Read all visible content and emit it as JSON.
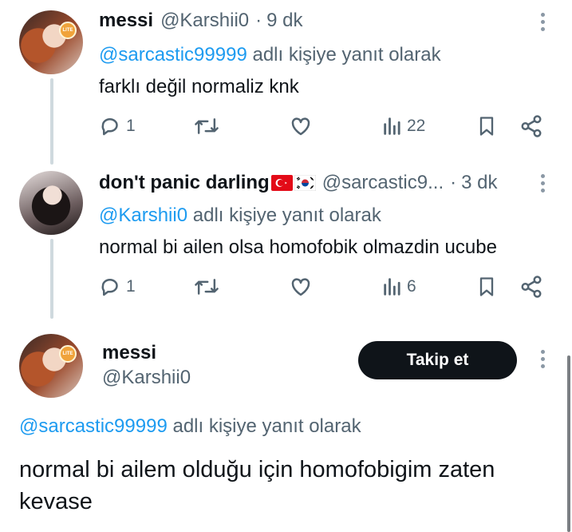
{
  "tweets": [
    {
      "display_name": "messi",
      "handle": "@Karshii0",
      "sep": "·",
      "time": "9 dk",
      "reply_handle": "@sarcastic99999",
      "reply_suffix": "adlı kişiye yanıt olarak",
      "text": "farklı değil normaliz knk",
      "replies": "1",
      "views": "22"
    },
    {
      "display_name": "don't panic darling",
      "handle": "@sarcastic9...",
      "sep": "·",
      "time": "3 dk",
      "reply_handle": "@Karshii0",
      "reply_suffix": "adlı kişiye yanıt olarak",
      "text": "normal bi ailen olsa homofobik olmazdin ucube",
      "replies": "1",
      "views": "6"
    }
  ],
  "main_tweet": {
    "display_name": "messi",
    "handle": "@Karshii0",
    "follow_label": "Takip et",
    "reply_handle": "@sarcastic99999",
    "reply_suffix": "adlı kişiye yanıt olarak",
    "text": "normal bi ailem olduğu için homofobigim zaten kevase"
  },
  "avatar_badge": "LITE",
  "colors": {
    "link": "#1d9bf0",
    "muted": "#536471",
    "button_bg": "#0f1419"
  },
  "icons": [
    "reply-icon",
    "retweet-icon",
    "like-icon",
    "views-icon",
    "bookmark-icon",
    "share-icon",
    "more-icon"
  ]
}
